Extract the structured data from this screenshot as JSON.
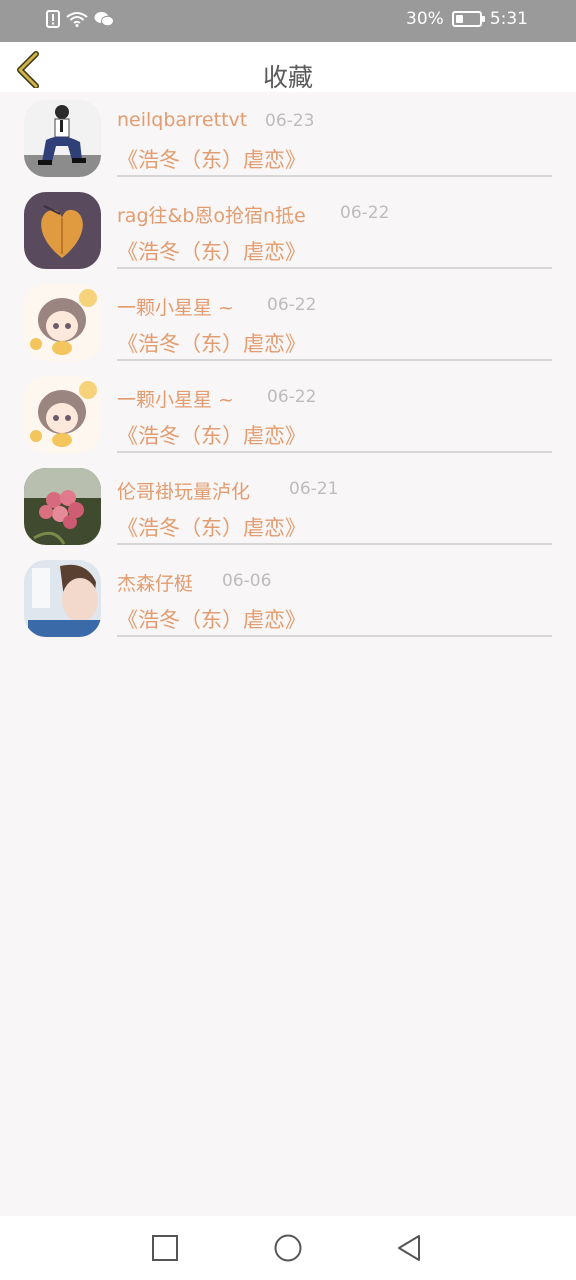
{
  "status_bar": {
    "battery": "30%",
    "battery_level": 0.3,
    "time": "5:31",
    "left_icons": [
      "sim-alert-icon",
      "wifi-icon",
      "wechat-icon"
    ]
  },
  "header": {
    "title": "收藏",
    "back_icon": "chevron-left-icon",
    "accent": "#d3b24a"
  },
  "colors": {
    "name": "#e39c6f",
    "book": "#e39c6f",
    "date": "#bcbcbc"
  },
  "favorites": [
    {
      "user": "neilqbarrettvt",
      "date": "06-23",
      "book": "《浩冬（东）虐恋》",
      "avatar": "boy-sitting-photo"
    },
    {
      "user": "rag往&b恩o抢宿n抵e",
      "date": "06-22",
      "book": "《浩冬（东）虐恋》",
      "avatar": "leaf-heart-photo"
    },
    {
      "user": "一颗小星星 ~",
      "date": "06-22",
      "book": "《浩冬（东）虐恋》",
      "avatar": "anime-girl-illustration"
    },
    {
      "user": "一颗小星星 ~",
      "date": "06-22",
      "book": "《浩冬（东）虐恋》",
      "avatar": "anime-girl-illustration"
    },
    {
      "user": "伦哥褂玩量泸化",
      "date": "06-21",
      "book": "《浩冬（东）虐恋》",
      "avatar": "pink-flowers-photo"
    },
    {
      "user": "杰森仔梃",
      "date": "06-06",
      "book": "《浩冬（东）虐恋》",
      "avatar": "boy-portrait-photo"
    }
  ],
  "nav_bar": {
    "buttons": [
      "recents-square-icon",
      "home-circle-icon",
      "back-triangle-icon"
    ]
  }
}
